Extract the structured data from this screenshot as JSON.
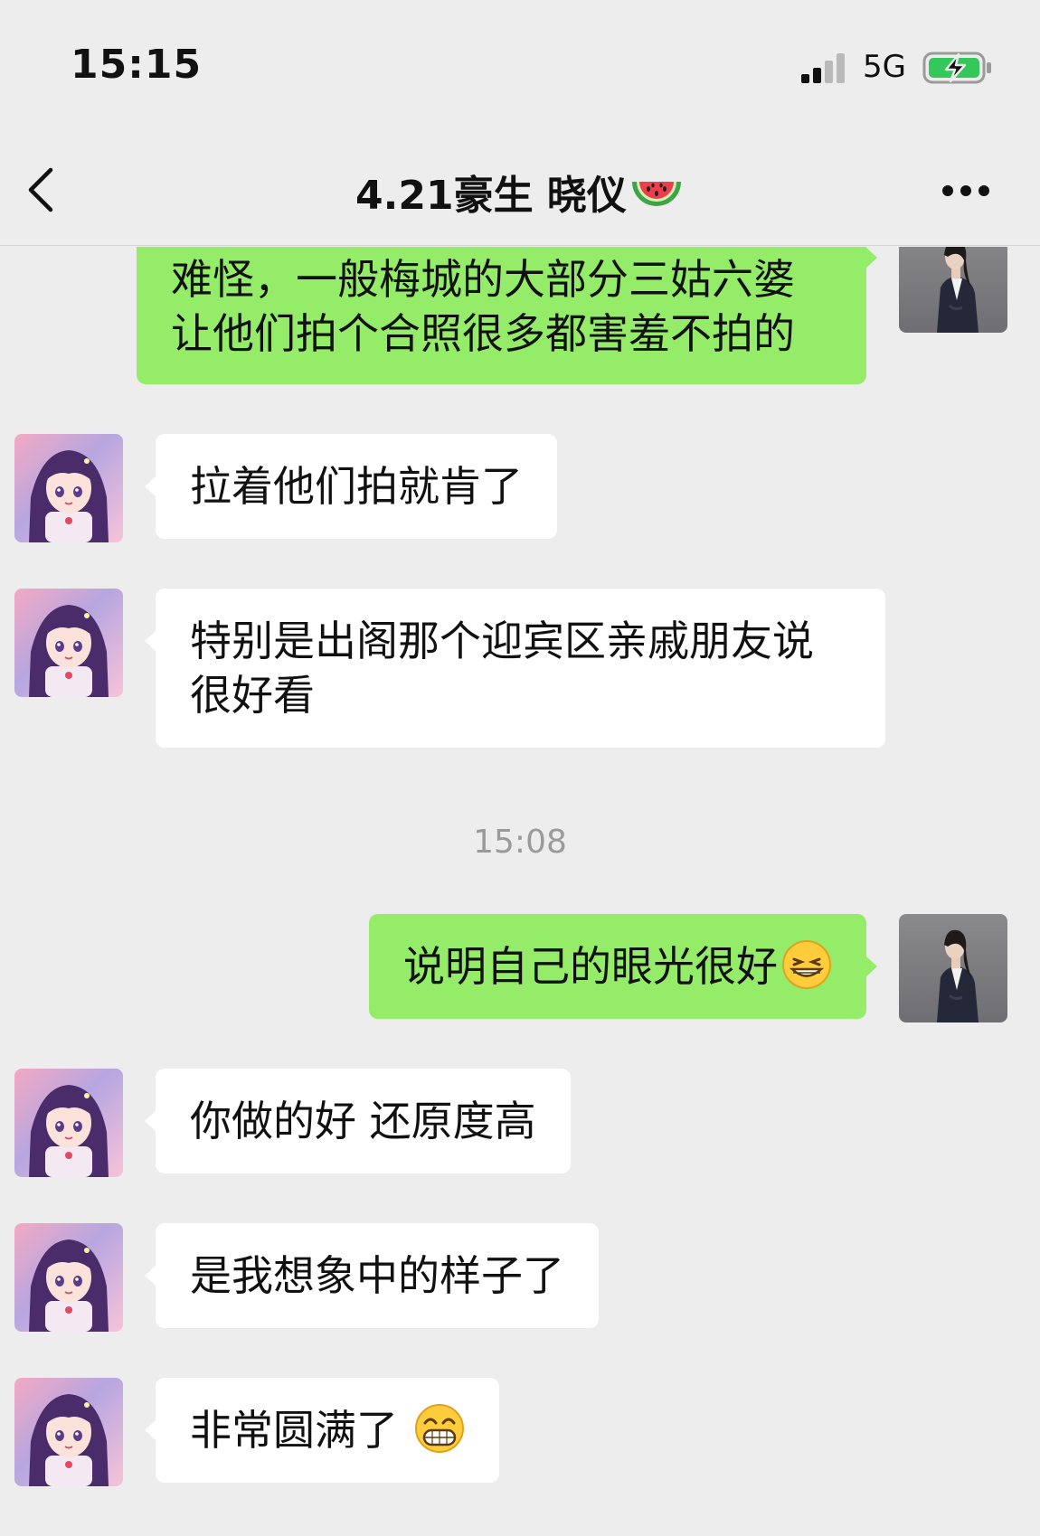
{
  "status_bar": {
    "time": "15:15",
    "network": "5G",
    "battery_icon": "battery-charging-icon",
    "signal_icon": "signal-strength-icon"
  },
  "nav": {
    "back_icon": "back-chevron-icon",
    "title": "4.21豪生 晓仪",
    "title_emoji": "watermelon-icon",
    "more_icon": "more-dots-icon"
  },
  "messages": [
    {
      "sender": "me",
      "text": "难怪，一般梅城的大部分三姑六婆让他们拍个合照很多都害羞不拍的"
    },
    {
      "sender": "contact",
      "text": "拉着他们拍就肯了"
    },
    {
      "sender": "contact",
      "text": "特别是出阁那个迎宾区亲戚朋友说很好看"
    },
    {
      "type": "timestamp",
      "text": "15:08"
    },
    {
      "sender": "me",
      "text": "说明自己的眼光很好",
      "emoji": "grin-emoji-icon"
    },
    {
      "sender": "contact",
      "text": "你做的好 还原度高"
    },
    {
      "sender": "contact",
      "text": "是我想象中的样子了"
    },
    {
      "sender": "contact",
      "text": "非常圆满了",
      "emoji": "beaming-face-emoji-icon"
    }
  ],
  "colors": {
    "background": "#ededed",
    "outgoing_bubble": "#95ec69",
    "incoming_bubble": "#ffffff",
    "timestamp_text": "#9a9a9a",
    "battery_fill": "#34c759"
  }
}
